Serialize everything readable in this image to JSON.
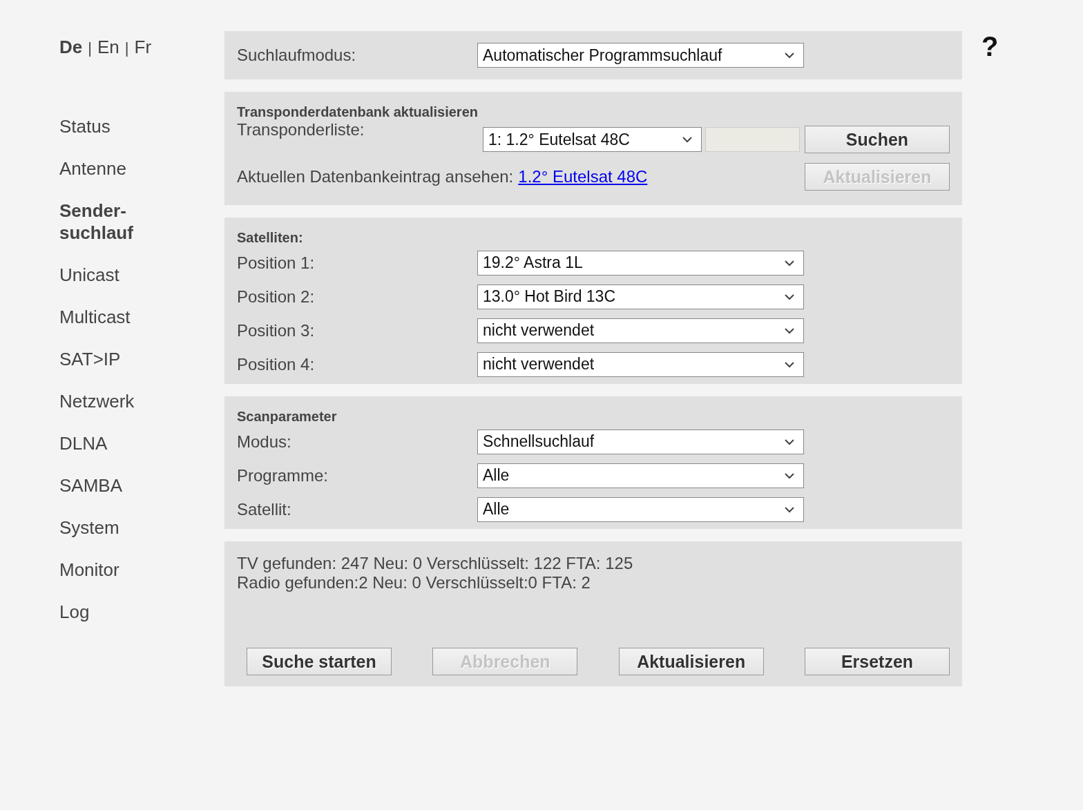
{
  "languages": [
    {
      "label": "De",
      "selected": true
    },
    {
      "label": "En",
      "selected": false
    },
    {
      "label": "Fr",
      "selected": false
    }
  ],
  "language_separator": "|",
  "sidebar": {
    "items": [
      {
        "label": "Status",
        "selected": false
      },
      {
        "label": "Antenne",
        "selected": false
      },
      {
        "label": "Sender-suchlauf",
        "selected": true
      },
      {
        "label": "Unicast",
        "selected": false
      },
      {
        "label": "Multicast",
        "selected": false
      },
      {
        "label": "SAT>IP",
        "selected": false
      },
      {
        "label": "Netzwerk",
        "selected": false
      },
      {
        "label": "DLNA",
        "selected": false
      },
      {
        "label": "SAMBA",
        "selected": false
      },
      {
        "label": "System",
        "selected": false
      },
      {
        "label": "Monitor",
        "selected": false
      },
      {
        "label": "Log",
        "selected": false
      }
    ]
  },
  "help": "?",
  "search_mode": {
    "label": "Suchlaufmodus:",
    "value": "Automatischer Programmsuchlauf"
  },
  "transponder": {
    "title": "Transponderdatenbank aktualisieren",
    "label": "Transponderliste:",
    "value": "1: 1.2° Eutelsat 48C",
    "search_button": {
      "label": "Suchen",
      "disabled": false
    },
    "view_label": "Aktuellen Datenbankeintrag ansehen:",
    "view_link": "1.2° Eutelsat 48C",
    "update_button": {
      "label": "Aktualisieren",
      "disabled": true
    }
  },
  "satellites": {
    "title": "Satelliten:",
    "rows": [
      {
        "label": "Position 1:",
        "value": "19.2° Astra 1L"
      },
      {
        "label": "Position 2:",
        "value": "13.0° Hot Bird 13C"
      },
      {
        "label": "Position 3:",
        "value": "nicht verwendet"
      },
      {
        "label": "Position 4:",
        "value": "nicht verwendet"
      }
    ]
  },
  "scan": {
    "title": "Scanparameter",
    "rows": [
      {
        "label": "Modus:",
        "value": "Schnellsuchlauf"
      },
      {
        "label": "Programme:",
        "value": "Alle"
      },
      {
        "label": "Satellit:",
        "value": "Alle"
      }
    ]
  },
  "results": [
    "TV gefunden: 247 Neu: 0 Verschlüsselt: 122 FTA: 125",
    "Radio gefunden:2 Neu: 0 Verschlüsselt:0 FTA: 2"
  ],
  "buttons": [
    {
      "label": "Suche starten",
      "disabled": false
    },
    {
      "label": "Abbrechen",
      "disabled": true
    },
    {
      "label": "Aktualisieren",
      "disabled": false
    },
    {
      "label": "Ersetzen",
      "disabled": false
    }
  ]
}
